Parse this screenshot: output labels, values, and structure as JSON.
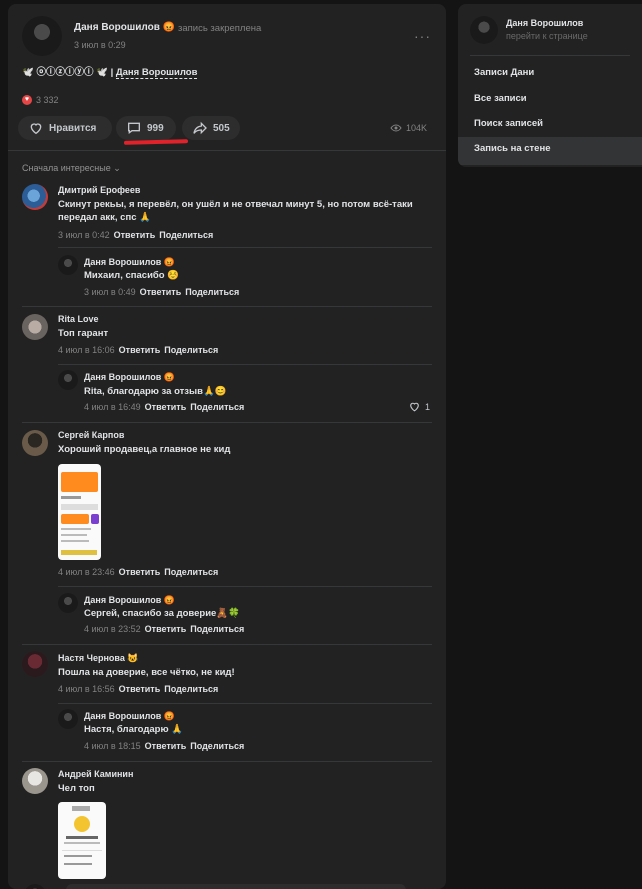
{
  "post": {
    "author": "Даня Ворошилов",
    "author_emoji": "😡",
    "pinned": "запись закреплена",
    "date": "3 июл в 0:29",
    "text_prefix": "🕊️ ⓞⓘⓩⓘⓨⓘ 🕊️ |",
    "text_link": "Даня Ворошилов",
    "reactions_count": "3 332",
    "like_label": "Нравится",
    "comments_count": "999",
    "shares_count": "505",
    "views": "104K",
    "sort_label": "Сначала интересные"
  },
  "comments": [
    {
      "author": "Дмитрий Ерофеев",
      "text1": "Скинут рекьы, я перевёл, он ушёл и не отвечал минут 5, но потом всё-таки",
      "text2": "передал акк, спс 🙏",
      "date": "3 июл в 0:42",
      "reply": "Ответить",
      "share": "Поделиться"
    },
    {
      "author": "Даня Ворошилов 😡",
      "text": "Михаил, спасибо ☺️",
      "date": "3 июл в 0:49",
      "reply": "Ответить",
      "share": "Поделиться"
    },
    {
      "author": "Rita Love",
      "text": "Топ гарант",
      "date": "4 июл в 16:06",
      "reply": "Ответить",
      "share": "Поделиться"
    },
    {
      "author": "Даня Ворошилов 😡",
      "text": "Rita, благодарю за отзыв🙏😊",
      "date": "4 июл в 16:49",
      "reply": "Ответить",
      "share": "Поделиться",
      "likes": "1"
    },
    {
      "author": "Сергей Карпов",
      "text": "Хороший продавец,а главное не кид",
      "date": "4 июл в 23:46",
      "reply": "Ответить",
      "share": "Поделиться"
    },
    {
      "author": "Даня Ворошилов 😡",
      "text": "Сергей, спасибо за доверие🧸🍀",
      "date": "4 июл в 23:52",
      "reply": "Ответить",
      "share": "Поделиться"
    },
    {
      "author": "Настя Чернова 😺",
      "text": "Пошла на доверие, все чётко, не кид!",
      "date": "4 июл в 16:56",
      "reply": "Ответить",
      "share": "Поделиться"
    },
    {
      "author": "Даня Ворошилов 😡",
      "text": "Настя, благодарю 🙏",
      "date": "4 июл в 18:15",
      "reply": "Ответить",
      "share": "Поделиться"
    },
    {
      "author": "Андрей Каминин",
      "text": "Чел топ"
    }
  ],
  "sidebar": {
    "name": "Даня Ворошилов",
    "link": "перейти к странице",
    "items": [
      "Записи Дани",
      "Все записи",
      "Поиск записей",
      "Запись на стене"
    ]
  },
  "colors": {
    "accent_red": "#e0232b",
    "bg": "#141414",
    "card": "#222222",
    "link": "#71aaeb"
  }
}
